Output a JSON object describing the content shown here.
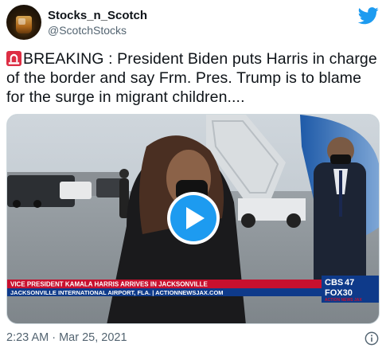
{
  "author": {
    "display_name": "Stocks_n_Scotch",
    "handle": "@ScotchStocks"
  },
  "tweet": {
    "icon": "police-light-icon",
    "text": "BREAKING : President Biden puts Harris in charge of the border and say Frm. Pres. Trump is to blame for the surge in migrant children....",
    "timestamp": "2:23 AM · Mar 25, 2021"
  },
  "video": {
    "lower_third_headline": "VICE PRESIDENT KAMALA HARRIS ARRIVES IN JACKSONVILLE",
    "lower_third_sub": "JACKSONVILLE INTERNATIONAL AIRPORT, FLA. | ACTIONNEWSJAX.COM",
    "logo_top": "CBS",
    "logo_top_number": "47",
    "logo_bottom": "FOX30",
    "logo_tag": "ACTION NEWS JAX"
  },
  "colors": {
    "twitter_blue": "#1d9bf0",
    "play_button_blue": "#1d9bf0",
    "lower_third_red": "#c8102e",
    "lower_third_blue": "#0e3a8a"
  }
}
